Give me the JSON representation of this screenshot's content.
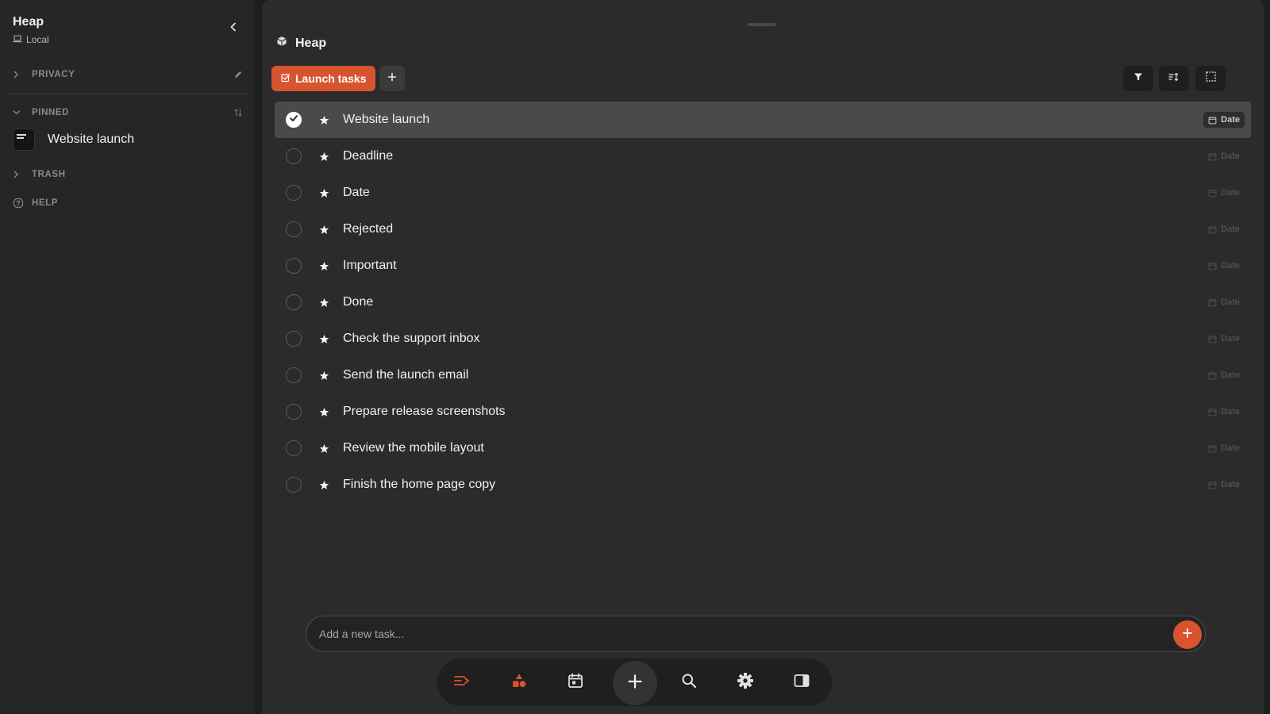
{
  "sidebar": {
    "title": "Heap",
    "location": "Local",
    "sections": {
      "privacy": "PRIVACY",
      "pinned": "PINNED",
      "trash": "TRASH",
      "help": "HELP"
    },
    "pinned_items": [
      {
        "label": "Website launch"
      }
    ]
  },
  "main": {
    "title": "Heap",
    "tabs": [
      {
        "label": "Launch tasks",
        "active": true
      }
    ],
    "tasks": [
      {
        "title": "Website launch",
        "checked": true,
        "date_label": "Date"
      },
      {
        "title": "Deadline",
        "checked": false,
        "date_label": "Date"
      },
      {
        "title": "Date",
        "checked": false,
        "date_label": "Date"
      },
      {
        "title": "Rejected",
        "checked": false,
        "date_label": "Date"
      },
      {
        "title": "Important",
        "checked": false,
        "date_label": "Date"
      },
      {
        "title": "Done",
        "checked": false,
        "date_label": "Date"
      },
      {
        "title": "Check the support inbox",
        "checked": false,
        "date_label": "Date"
      },
      {
        "title": "Send the launch email",
        "checked": false,
        "date_label": "Date"
      },
      {
        "title": "Prepare release screenshots",
        "checked": false,
        "date_label": "Date"
      },
      {
        "title": "Review the mobile layout",
        "checked": false,
        "date_label": "Date"
      },
      {
        "title": "Finish the home page copy",
        "checked": false,
        "date_label": "Date"
      }
    ],
    "composer": {
      "placeholder": "Add a new task..."
    }
  },
  "toolbar_icons": [
    "filter-icon",
    "sort-icon",
    "select-icon"
  ],
  "dock_icons": [
    "tasks-list-icon",
    "shapes-icon",
    "calendar-icon",
    "plus-icon",
    "search-icon",
    "gear-icon",
    "sidebar-panel-icon"
  ],
  "colors": {
    "accent": "#d8542f",
    "sidebar_bg": "#262626",
    "main_bg": "#2b2b2b",
    "selected_row": "#4a4a4a"
  }
}
